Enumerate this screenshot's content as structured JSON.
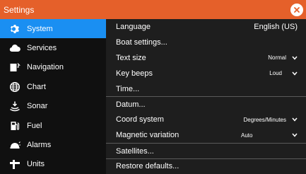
{
  "titlebar": {
    "title": "Settings"
  },
  "sidebar": {
    "items": [
      {
        "label": "System",
        "icon": "gear-icon",
        "active": true
      },
      {
        "label": "Services",
        "icon": "cloud-icon"
      },
      {
        "label": "Navigation",
        "icon": "navigation-icon"
      },
      {
        "label": "Chart",
        "icon": "globe-icon"
      },
      {
        "label": "Sonar",
        "icon": "sonar-icon"
      },
      {
        "label": "Fuel",
        "icon": "fuel-pump-icon"
      },
      {
        "label": "Alarms",
        "icon": "alarm-icon"
      },
      {
        "label": "Units",
        "icon": "units-icon"
      }
    ]
  },
  "main": {
    "language_label": "Language",
    "language_value": "English (US)",
    "boat_settings": "Boat settings...",
    "text_size_label": "Text size",
    "text_size_value": "Normal",
    "key_beeps_label": "Key beeps",
    "key_beeps_value": "Loud",
    "time_label": "Time...",
    "datum_label": "Datum...",
    "coord_label": "Coord system",
    "coord_value": "Degrees/Minutes",
    "magvar_label": "Magnetic variation",
    "magvar_value": "Auto",
    "satellites_label": "Satellites...",
    "restore_label": "Restore defaults..."
  },
  "colors": {
    "titlebar": "#e5602a",
    "active": "#1a8ff2",
    "sidebar_bg": "#101010",
    "main_bg": "#1e1e1e"
  }
}
